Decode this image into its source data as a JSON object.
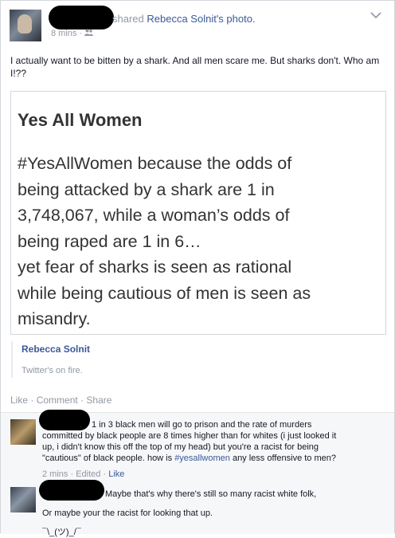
{
  "post": {
    "header_verb": "shared",
    "header_link": "Rebecca Solnit's photo.",
    "timestamp": "8 mins",
    "meta_sep": "·",
    "audience_icon": "friends-icon",
    "text": "I actually want to be bitten by a shark. And all men scare me. But sharks don't. Who am I!??"
  },
  "shared_photo": {
    "title": "Yes All Women",
    "lines": [
      "#YesAllWomen because the odds of",
      "being attacked by a shark are 1 in",
      "3,748,067, while a woman’s odds of",
      "being raped are 1 in 6…",
      "yet fear of sharks is seen as rational",
      "while being cautious of men is seen as",
      "misandry."
    ]
  },
  "attribution": {
    "name": "Rebecca Solnit",
    "description": "Twitter's on fire."
  },
  "actions": {
    "like": "Like",
    "comment": "Comment",
    "share": "Share",
    "sep": "·"
  },
  "comments": [
    {
      "line1": "1 in 3 black men will go to prison and the rate of murders",
      "line2": "committed by black people are 8 times higher than for whites (i just looked it",
      "line3": "up, i didn't know this off the top of my head) but you're a racist for being",
      "line4_pre": "\"cautious\" of black people. how is ",
      "hashtag": "#yesallwomen",
      "line4_post": " any less offensive to men?",
      "time": "2 mins",
      "sep": "·",
      "edited": "Edited",
      "like": "Like"
    },
    {
      "line1": "Maybe that's why there's still so many racist white folk,",
      "line2": "Or maybe your the racist for looking that up.",
      "line3": "¯\\_(ツ)_/¯"
    }
  ],
  "colors": {
    "link": "#3b5998",
    "muted": "#9197a3",
    "text": "#141823",
    "redaction": "#000000"
  }
}
